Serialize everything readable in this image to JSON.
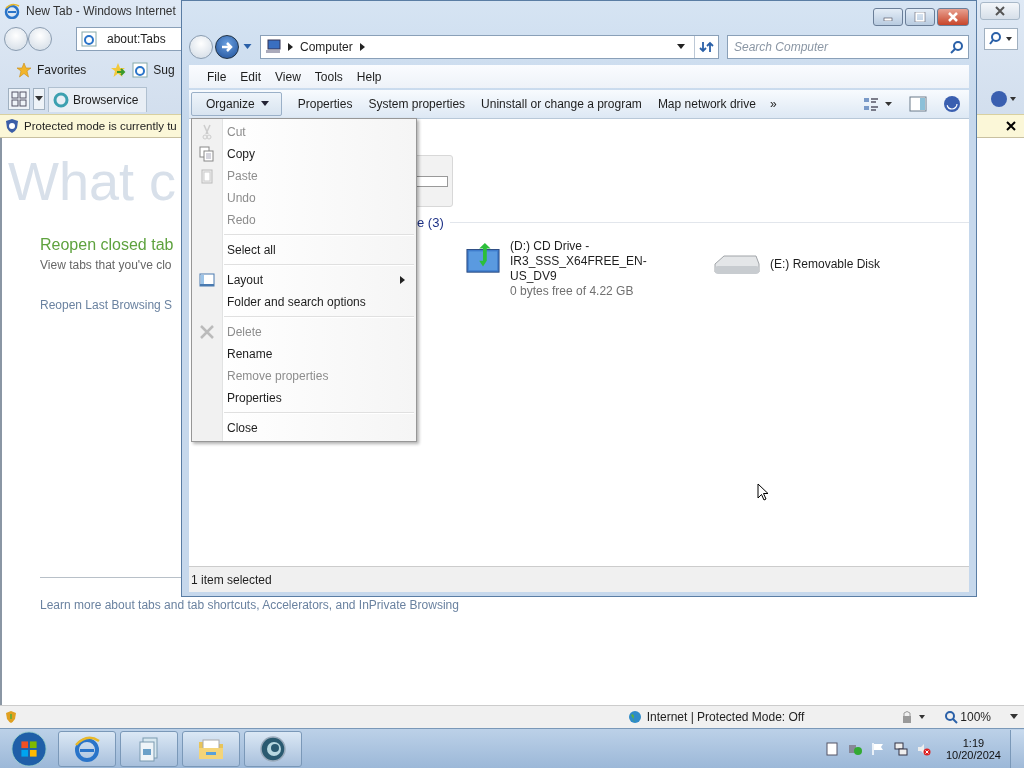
{
  "ie": {
    "title": "New Tab - Windows Internet",
    "address": "about:Tabs",
    "favorites": "Favorites",
    "suggested": "Sug",
    "tab": "Browservice",
    "infobar": "Protected mode is currently tu",
    "heading": "What c",
    "reopen_title": "Reopen closed tab",
    "reopen_text": "View tabs that you've clo",
    "reopen_last": "Reopen Last Browsing S",
    "learn_more": "Learn more about tabs and tab shortcuts, Accelerators, and InPrivate Browsing",
    "status_zone": "Internet | Protected Mode: Off",
    "zoom": "100%"
  },
  "explorer": {
    "breadcrumb": "Computer",
    "search_placeholder": "Search Computer",
    "menubar": [
      "File",
      "Edit",
      "View",
      "Tools",
      "Help"
    ],
    "commands": [
      "Properties",
      "System properties",
      "Uninstall or change a program",
      "Map network drive"
    ],
    "organize": "Organize",
    "more": "»",
    "group_header": "e (3)",
    "drives": [
      {
        "kind": "cd",
        "name": "(D:) CD Drive - IR3_SSS_X64FREE_EN-US_DV9",
        "detail": "0 bytes free of 4.22 GB"
      },
      {
        "kind": "removable",
        "name": "(E:) Removable Disk"
      }
    ],
    "status": "1 item selected"
  },
  "menu": {
    "groups": [
      {
        "items": [
          {
            "label": "Cut",
            "disabled": true
          },
          {
            "label": "Copy",
            "disabled": false
          },
          {
            "label": "Paste",
            "disabled": true
          },
          {
            "label": "Undo",
            "disabled": true
          },
          {
            "label": "Redo",
            "disabled": true
          }
        ]
      },
      {
        "items": [
          {
            "label": "Select all",
            "disabled": false
          }
        ]
      },
      {
        "items": [
          {
            "label": "Layout",
            "disabled": false,
            "submenu": true
          },
          {
            "label": "Folder and search options",
            "disabled": false
          }
        ]
      },
      {
        "items": [
          {
            "label": "Delete",
            "disabled": true
          },
          {
            "label": "Rename",
            "disabled": false
          },
          {
            "label": "Remove properties",
            "disabled": true
          },
          {
            "label": "Properties",
            "disabled": false
          }
        ]
      },
      {
        "items": [
          {
            "label": "Close",
            "disabled": false
          }
        ]
      }
    ]
  },
  "taskbar": {
    "time": "1:19",
    "date": "10/20/2024"
  }
}
